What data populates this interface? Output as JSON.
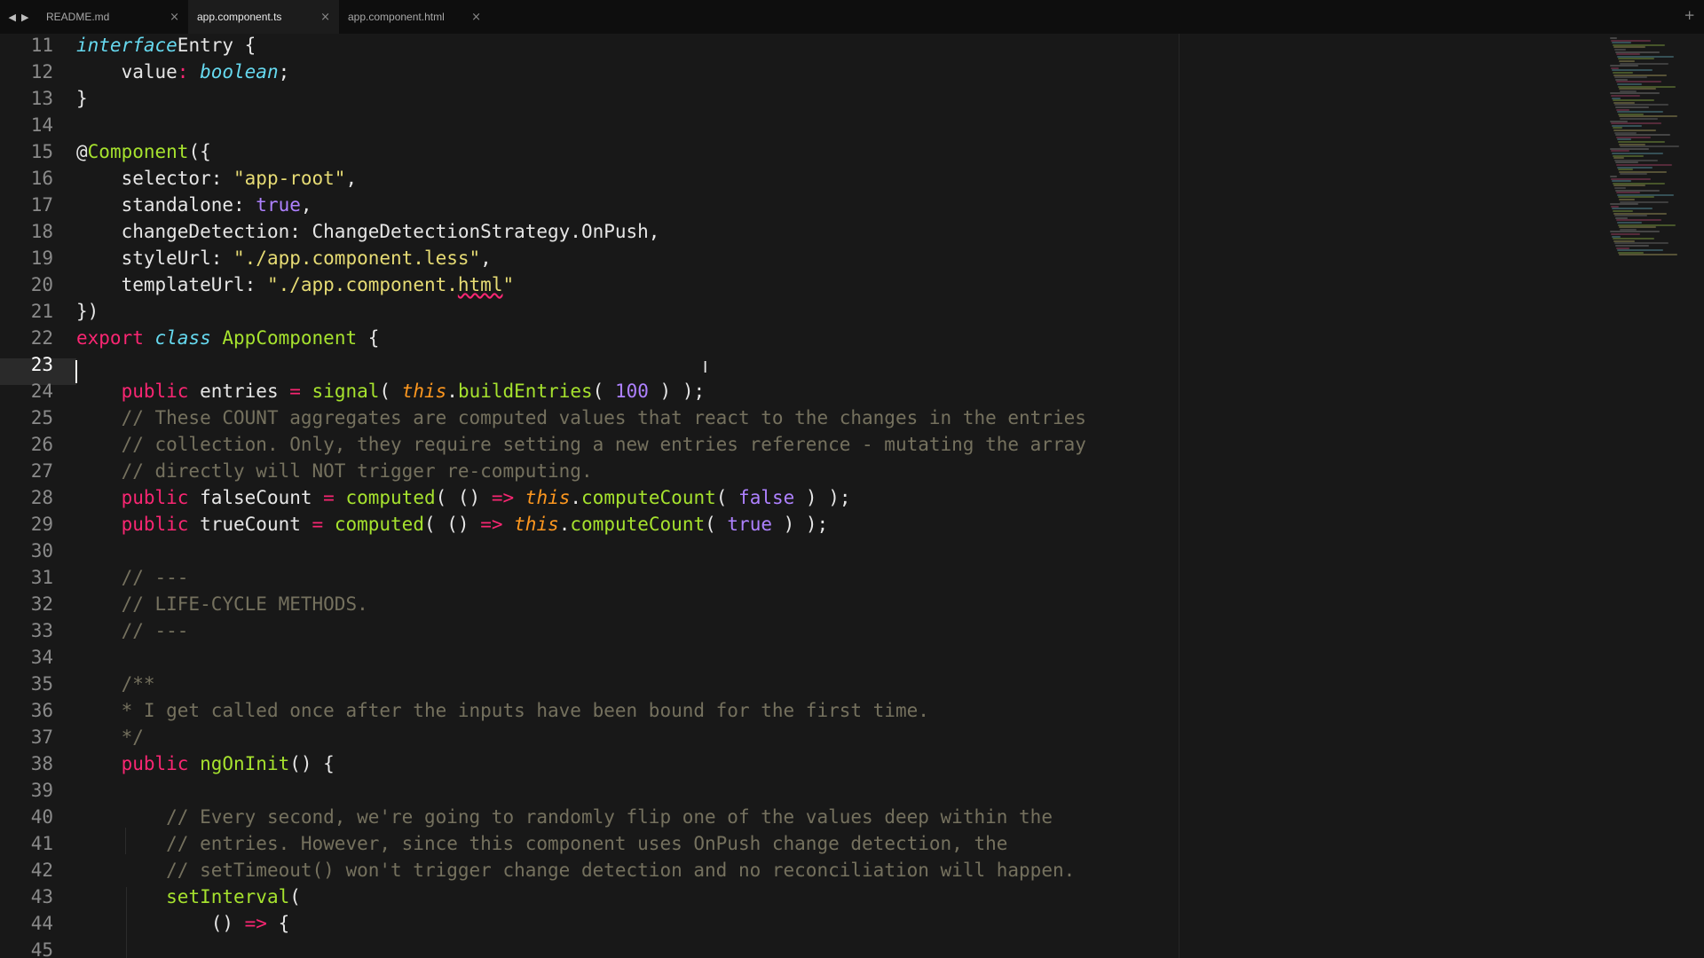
{
  "nav": {
    "back_glyph": "◀",
    "forward_glyph": "▶"
  },
  "tabs": [
    {
      "label": "README.md",
      "close": "×",
      "active": false
    },
    {
      "label": "app.component.ts",
      "close": "×",
      "active": true
    },
    {
      "label": "app.component.html",
      "close": "×",
      "active": false
    }
  ],
  "new_tab_glyph": "+",
  "editor": {
    "current_line": 23,
    "line_numbers": [
      "11",
      "12",
      "13",
      "14",
      "15",
      "16",
      "17",
      "18",
      "19",
      "20",
      "21",
      "22",
      "23",
      "24",
      "25",
      "26",
      "27",
      "28",
      "29",
      "30",
      "31",
      "32",
      "33",
      "34",
      "35",
      "36",
      "37",
      "38",
      "39",
      "40",
      "41",
      "42",
      "43",
      "44",
      "45"
    ],
    "lines": [
      [
        [
          "it ty",
          "interface"
        ],
        [
          "",
          "Entry {"
        ]
      ],
      [
        [
          "ind",
          "    "
        ],
        [
          "",
          "value"
        ],
        [
          "kw",
          ":"
        ],
        [
          "",
          ""
        ],
        [
          "it ty",
          " boolean"
        ],
        [
          "",
          ";"
        ]
      ],
      [
        [
          "",
          "}"
        ]
      ],
      [],
      [
        [
          "",
          "@"
        ],
        [
          "fn",
          "Component"
        ],
        [
          "",
          "({"
        ]
      ],
      [
        [
          "ind",
          "    "
        ],
        [
          "",
          "selector: "
        ],
        [
          "str",
          "\"app-root\""
        ],
        [
          "",
          ","
        ]
      ],
      [
        [
          "ind",
          "    "
        ],
        [
          "",
          "standalone: "
        ],
        [
          "num",
          "true"
        ],
        [
          "",
          ","
        ]
      ],
      [
        [
          "ind",
          "    "
        ],
        [
          "",
          "changeDetection: ChangeDetectionStrategy.OnPush,"
        ]
      ],
      [
        [
          "ind",
          "    "
        ],
        [
          "",
          "styleUrl: "
        ],
        [
          "str",
          "\"./app.component.less\""
        ],
        [
          "",
          ","
        ]
      ],
      [
        [
          "ind",
          "    "
        ],
        [
          "",
          "templateUrl: "
        ],
        [
          "str",
          "\"./app.component."
        ],
        [
          "str squiggle",
          "html"
        ],
        [
          "str",
          "\""
        ]
      ],
      [
        [
          "",
          "})"
        ]
      ],
      [
        [
          "kw",
          "export"
        ],
        [
          "",
          " "
        ],
        [
          "it ty",
          "class"
        ],
        [
          "",
          " "
        ],
        [
          "fn",
          "AppComponent"
        ],
        [
          "",
          " {"
        ]
      ],
      [],
      [
        [
          "ind",
          "    "
        ],
        [
          "kw",
          "public"
        ],
        [
          "",
          " entries "
        ],
        [
          "kw",
          "="
        ],
        [
          "",
          " "
        ],
        [
          "fn",
          "signal"
        ],
        [
          "",
          "( "
        ],
        [
          "thisk",
          "this"
        ],
        [
          "",
          "."
        ],
        [
          "fn",
          "buildEntries"
        ],
        [
          "",
          "( "
        ],
        [
          "num",
          "100"
        ],
        [
          "",
          " ) );"
        ]
      ],
      [
        [
          "ind",
          "    "
        ],
        [
          "cm",
          "// These COUNT aggregates are computed values that react to the changes in the entries"
        ]
      ],
      [
        [
          "ind",
          "    "
        ],
        [
          "cm",
          "// collection. Only, they require setting a new entries reference - mutating the array"
        ]
      ],
      [
        [
          "ind",
          "    "
        ],
        [
          "cm",
          "// directly will NOT trigger re-computing."
        ]
      ],
      [
        [
          "ind",
          "    "
        ],
        [
          "kw",
          "public"
        ],
        [
          "",
          " falseCount "
        ],
        [
          "kw",
          "="
        ],
        [
          "",
          " "
        ],
        [
          "fn",
          "computed"
        ],
        [
          "",
          "( () "
        ],
        [
          "kw",
          "=>"
        ],
        [
          "",
          " "
        ],
        [
          "thisk",
          "this"
        ],
        [
          "",
          "."
        ],
        [
          "fn",
          "computeCount"
        ],
        [
          "",
          "( "
        ],
        [
          "num",
          "false"
        ],
        [
          "",
          " ) );"
        ]
      ],
      [
        [
          "ind",
          "    "
        ],
        [
          "kw",
          "public"
        ],
        [
          "",
          " trueCount "
        ],
        [
          "kw",
          "="
        ],
        [
          "",
          " "
        ],
        [
          "fn",
          "computed"
        ],
        [
          "",
          "( () "
        ],
        [
          "kw",
          "=>"
        ],
        [
          "",
          " "
        ],
        [
          "thisk",
          "this"
        ],
        [
          "",
          "."
        ],
        [
          "fn",
          "computeCount"
        ],
        [
          "",
          "( "
        ],
        [
          "num",
          "true"
        ],
        [
          "",
          " ) );"
        ]
      ],
      [],
      [
        [
          "ind",
          "    "
        ],
        [
          "cm",
          "// ---"
        ]
      ],
      [
        [
          "ind",
          "    "
        ],
        [
          "cm",
          "// LIFE-CYCLE METHODS."
        ]
      ],
      [
        [
          "ind",
          "    "
        ],
        [
          "cm",
          "// ---"
        ]
      ],
      [],
      [
        [
          "ind",
          "    "
        ],
        [
          "cm",
          "/**"
        ]
      ],
      [
        [
          "ind",
          "    "
        ],
        [
          "cm",
          "* I get called once after the inputs have been bound for the first time."
        ]
      ],
      [
        [
          "ind",
          "    "
        ],
        [
          "cm",
          "*/"
        ]
      ],
      [
        [
          "ind",
          "    "
        ],
        [
          "kw",
          "public"
        ],
        [
          "",
          " "
        ],
        [
          "fn",
          "ngOnInit"
        ],
        [
          "",
          "() {"
        ]
      ],
      [],
      [
        [
          "ind",
          "        "
        ],
        [
          "cm",
          "// Every second, we're going to randomly flip one of the values deep within the"
        ]
      ],
      [
        [
          "ind",
          "        "
        ],
        [
          "cm",
          "// entries. However, since this component uses OnPush change detection, the"
        ]
      ],
      [
        [
          "ind",
          "        "
        ],
        [
          "cm",
          "// setTimeout() won't trigger change detection and no reconciliation will happen."
        ]
      ],
      [
        [
          "ind",
          "        "
        ],
        [
          "fn",
          "setInterval"
        ],
        [
          "",
          "("
        ]
      ],
      [
        [
          "ind",
          "            "
        ],
        [
          "",
          "() "
        ],
        [
          "kw",
          "=>"
        ],
        [
          "",
          " {"
        ]
      ],
      []
    ]
  },
  "colors": {
    "background": "#181818",
    "tab_bar": "#0e0e0e",
    "keyword": "#f92672",
    "type": "#66d9ef",
    "function": "#a6e22e",
    "string": "#e6db74",
    "number": "#ae81ff",
    "this": "#fd971f",
    "comment": "#75715e"
  }
}
